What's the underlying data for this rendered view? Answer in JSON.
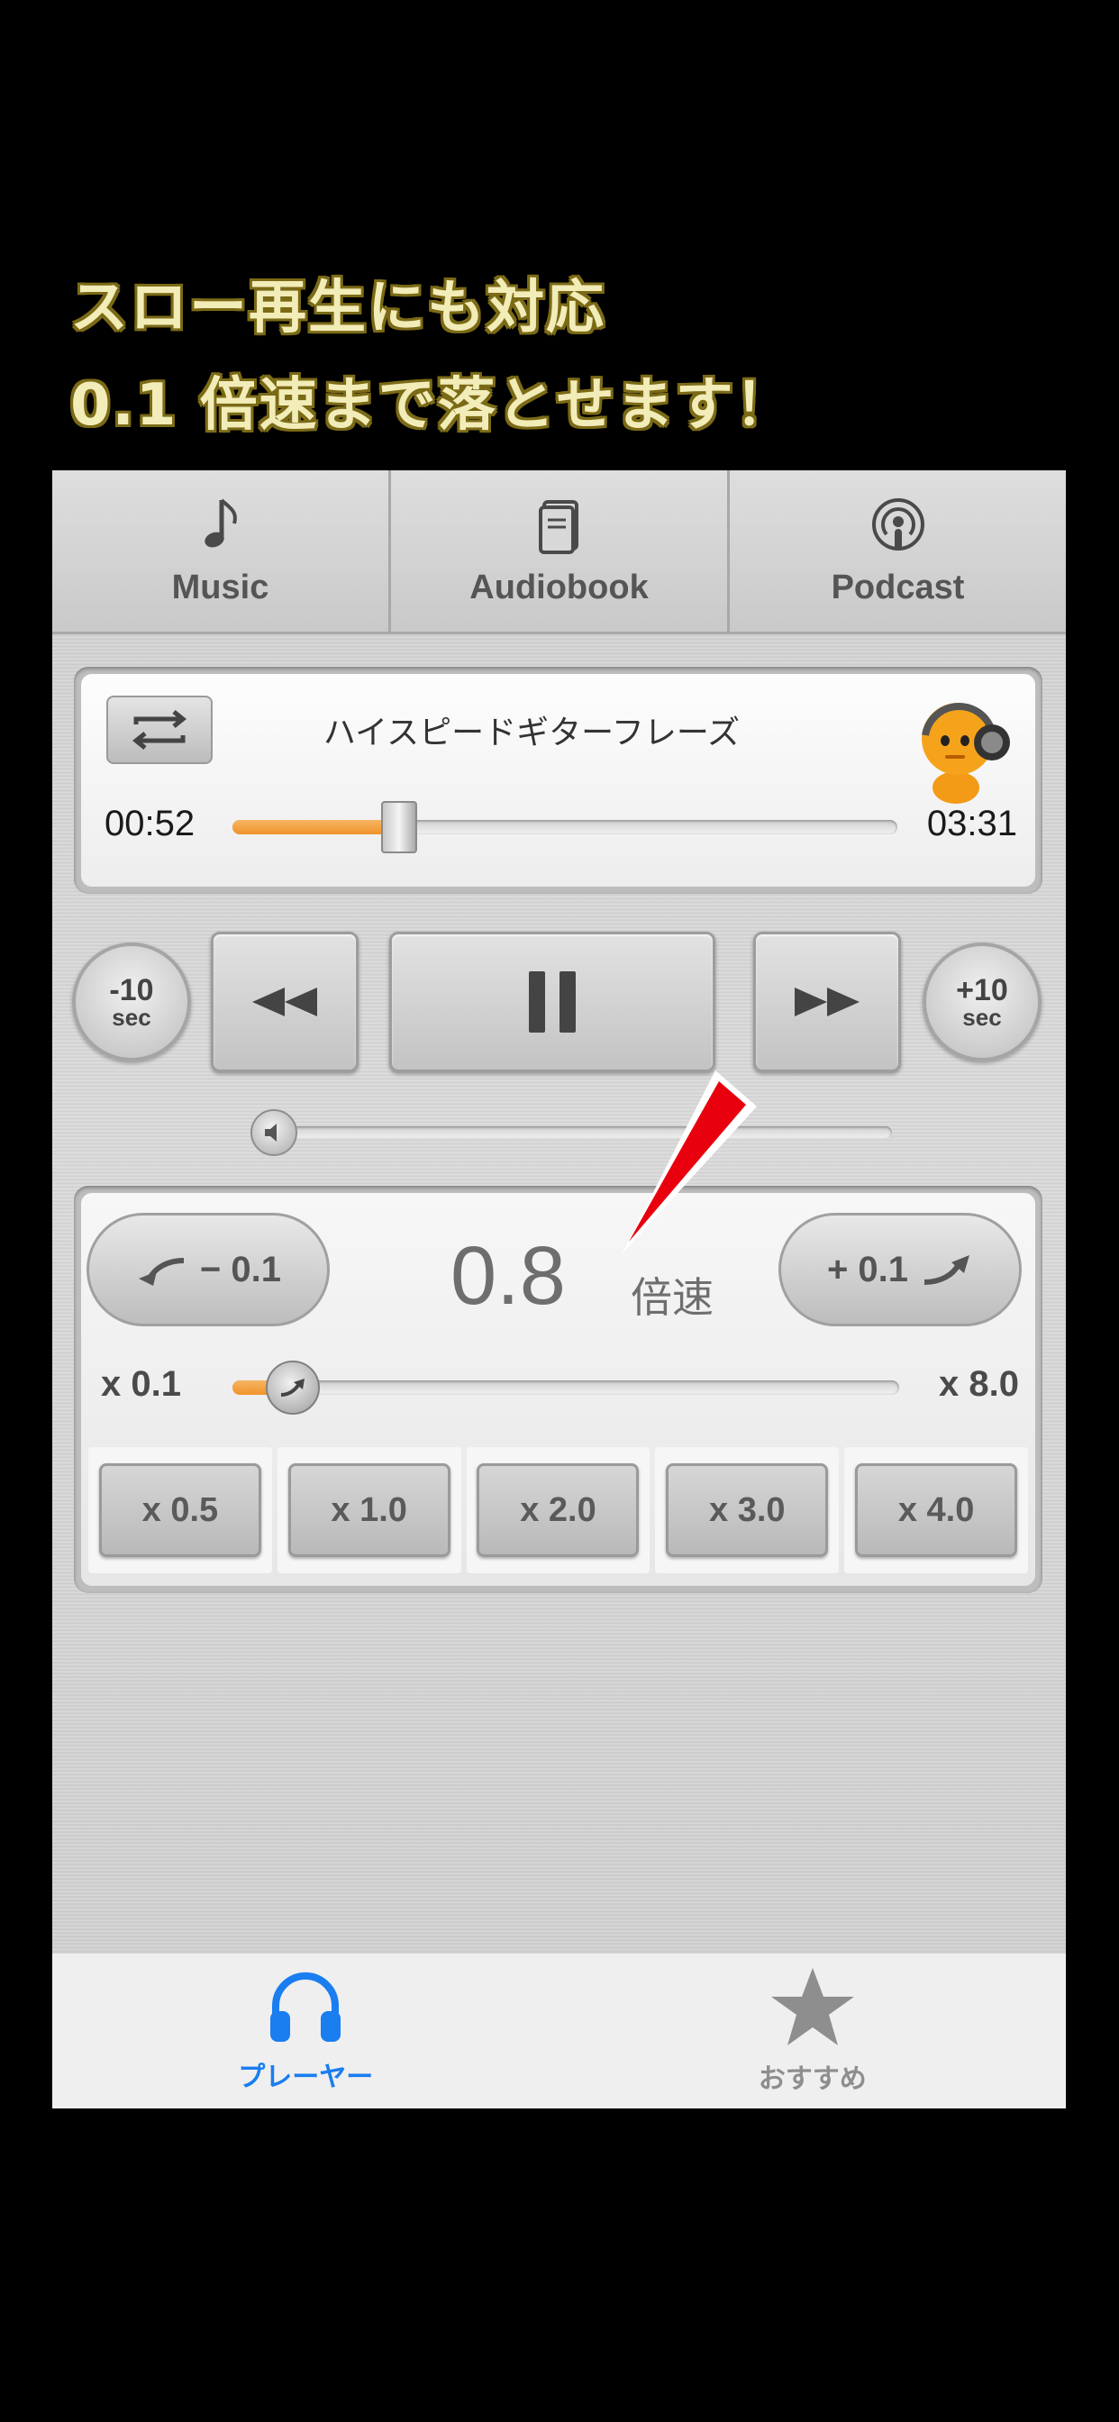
{
  "caption": {
    "line1": "スロー再生にも対応",
    "line2": "0.1 倍速まで落とせます！"
  },
  "source_tabs": [
    {
      "label": "Music",
      "icon": "music-note-icon"
    },
    {
      "label": "Audiobook",
      "icon": "book-icon"
    },
    {
      "label": "Podcast",
      "icon": "podcast-icon"
    }
  ],
  "now_playing": {
    "title": "ハイスピードギターフレーズ",
    "current_time": "00:52",
    "total_time": "03:31",
    "progress": 0.25
  },
  "transport": {
    "back10": {
      "num": "-10",
      "unit": "sec"
    },
    "fwd10": {
      "num": "+10",
      "unit": "sec"
    },
    "volume": 0.0
  },
  "speed": {
    "minus_label": "− 0.1",
    "plus_label": "+ 0.1",
    "value": "0.8",
    "unit": "倍速",
    "min_label": "x 0.1",
    "max_label": "x 8.0",
    "slider_fraction": 0.09,
    "presets": [
      "x 0.5",
      "x 1.0",
      "x 2.0",
      "x 3.0",
      "x 4.0"
    ]
  },
  "tabbar": {
    "player": "プレーヤー",
    "recommended": "おすすめ",
    "active_color": "#1a7df0",
    "inactive_color": "#8e8e8e"
  },
  "colors": {
    "accent_orange": "#f0932a",
    "arrow_red": "#e8000e"
  }
}
